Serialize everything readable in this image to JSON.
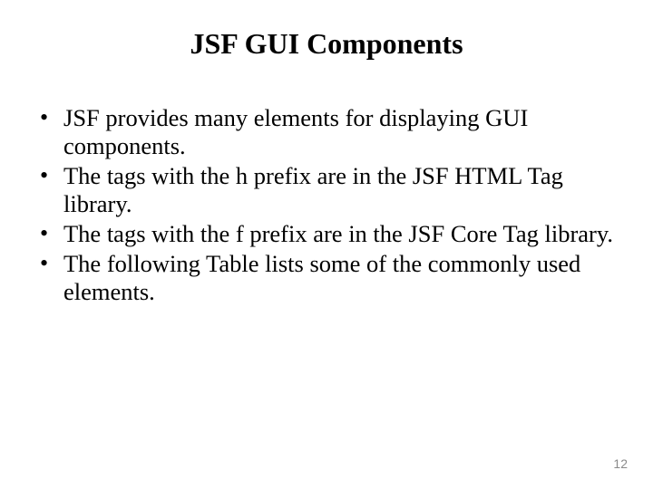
{
  "title": "JSF GUI Components",
  "bullets": [
    "JSF provides many elements for displaying GUI components.",
    "The tags with the h prefix are in the JSF HTML Tag library.",
    "The tags with the f prefix are in the JSF Core Tag library.",
    "The following Table lists some of the commonly used elements."
  ],
  "page_number": "12"
}
